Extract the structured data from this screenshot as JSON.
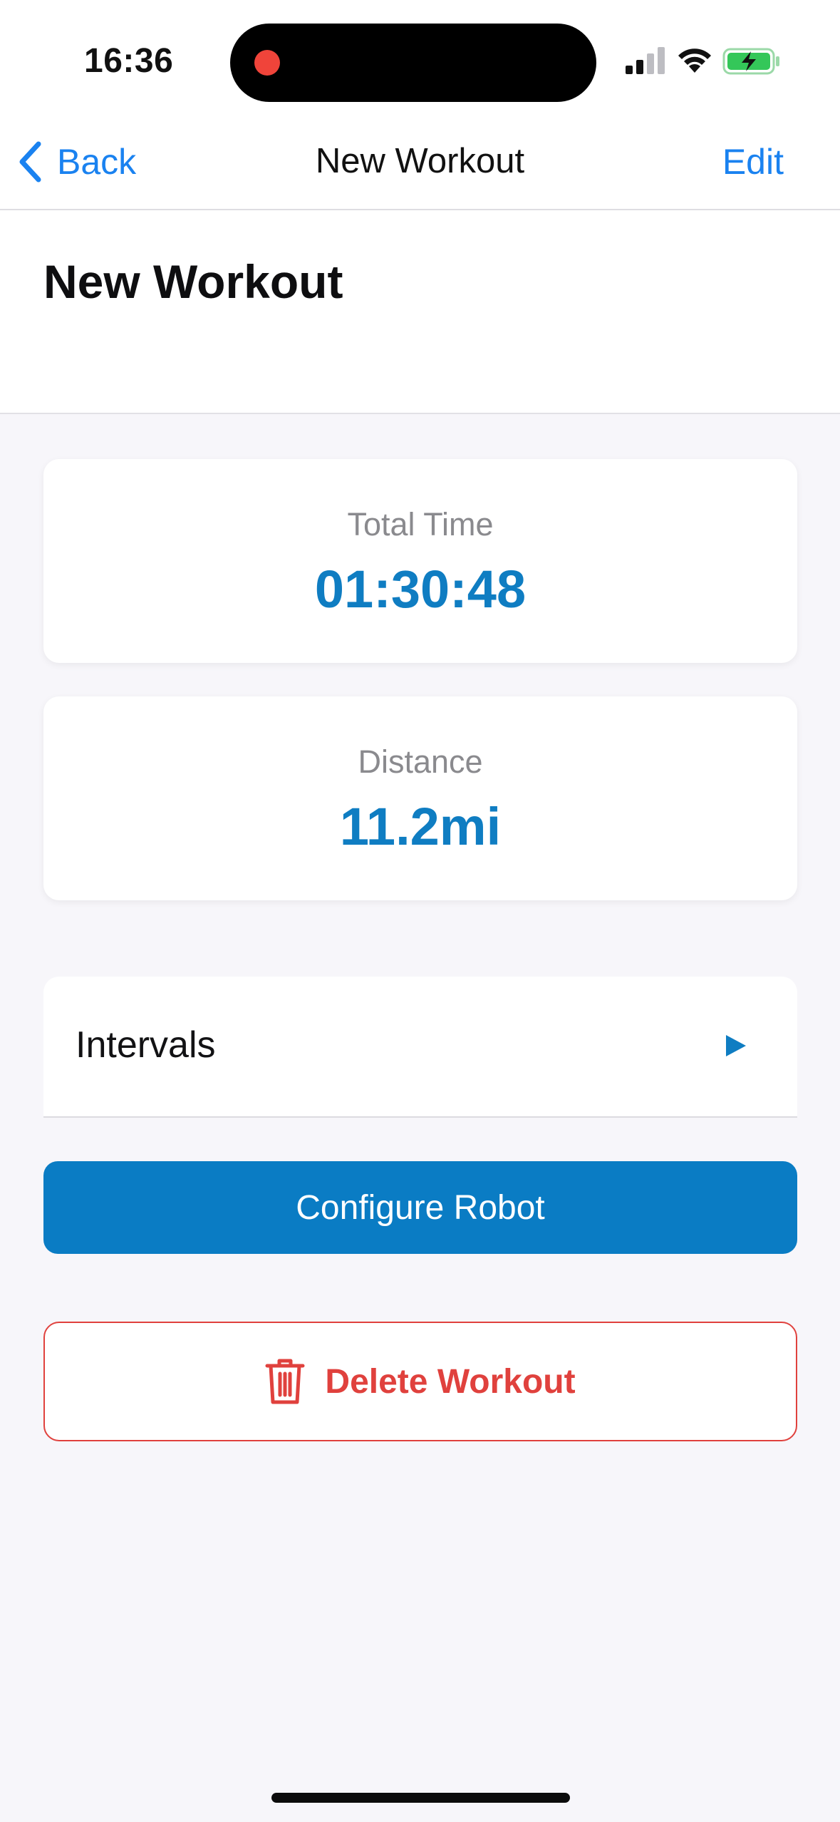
{
  "status_bar": {
    "time": "16:36",
    "icons": [
      "recording-indicator-icon",
      "cellular-signal-icon",
      "wifi-icon",
      "battery-charging-icon"
    ],
    "recording_color": "#F0443A",
    "battery_color": "#34C759"
  },
  "nav_bar": {
    "back_label": "Back",
    "title": "New Workout",
    "edit_label": "Edit",
    "accent_color": "#1A82F0"
  },
  "page": {
    "title": "New Workout"
  },
  "stats": [
    {
      "label": "Total Time",
      "value": "01:30:48"
    },
    {
      "label": "Distance",
      "value": "11.2mi"
    }
  ],
  "stat_value_color": "#0F7DC2",
  "intervals": {
    "label": "Intervals",
    "icon": "play-arrow-icon",
    "icon_color": "#0F7DC2"
  },
  "actions": {
    "configure_label": "Configure Robot",
    "configure_color": "#0A7CC4",
    "delete_label": "Delete Workout",
    "delete_icon": "trash-icon",
    "delete_color": "#E0413D"
  }
}
